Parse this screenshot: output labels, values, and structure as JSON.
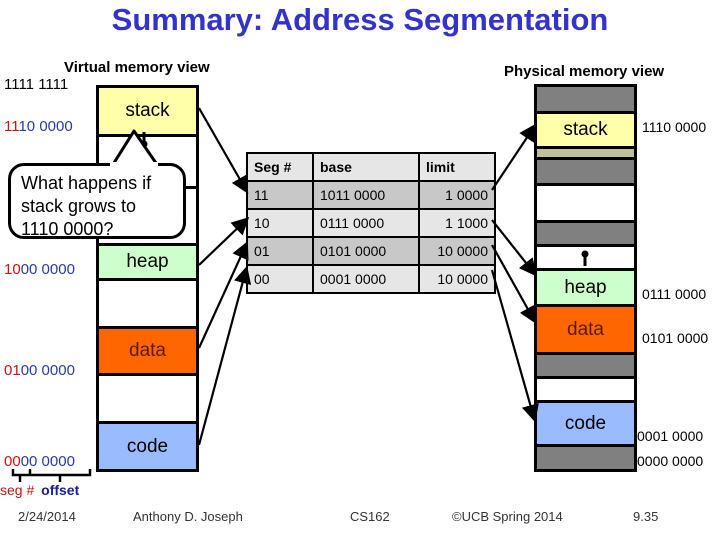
{
  "title": "Summary: Address Segmentation",
  "virtual": {
    "heading": "Virtual memory view",
    "top_address": "1111 1111",
    "addresses": [
      {
        "seg": "11",
        "offset": "10 0000"
      },
      {
        "seg": "10",
        "offset": "00 0000"
      },
      {
        "seg": "01",
        "offset": "00 0000"
      },
      {
        "seg": "00",
        "offset": "00 0000"
      }
    ],
    "segments": [
      "stack",
      "heap",
      "data",
      "code"
    ],
    "legend": {
      "seg": "seg #",
      "offset": "offset"
    }
  },
  "callout": {
    "line1": "What happens if",
    "line2": "stack grows to",
    "line3": "1110 0000?"
  },
  "segment_table": {
    "headers": [
      "Seg #",
      "base",
      "limit"
    ],
    "rows": [
      {
        "seg": "11",
        "base": "1011 0000",
        "limit": "1 0000"
      },
      {
        "seg": "10",
        "base": "0111 0000",
        "limit": "1 1000"
      },
      {
        "seg": "01",
        "base": "0101 0000",
        "limit": "10 0000"
      },
      {
        "seg": "00",
        "base": "0001 0000",
        "limit": "10 0000"
      }
    ]
  },
  "physical": {
    "heading": "Physical memory view",
    "segments": [
      "stack",
      "heap",
      "data",
      "code"
    ],
    "addresses": [
      "1110 0000",
      "0111 0000",
      "0101 0000",
      "0001 0000",
      "0000 0000"
    ]
  },
  "footer": {
    "date": "2/24/2014",
    "author": "Anthony D. Joseph",
    "course": "CS162",
    "copyright": "©UCB Spring 2014",
    "page": "9.35"
  }
}
